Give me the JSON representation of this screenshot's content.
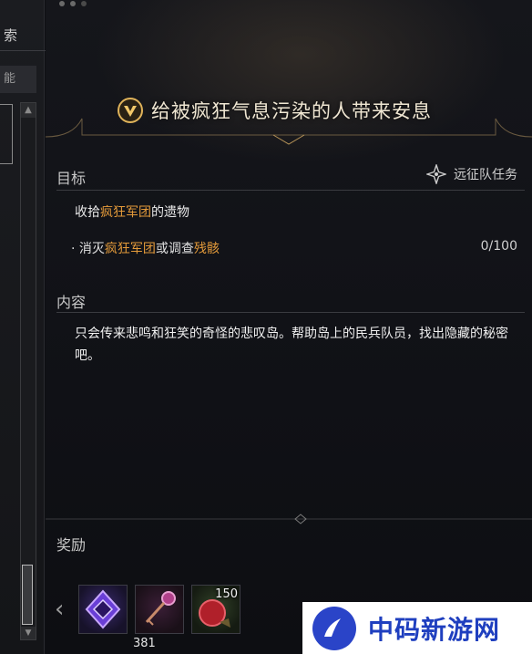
{
  "left": {
    "tab_top": "索",
    "tab_second": "能",
    "scroll_up": "▲",
    "scroll_down": "▼"
  },
  "quest": {
    "title": "给被疯狂气息污染的人带来安息",
    "icon": "quest-crest-icon"
  },
  "objective": {
    "heading": "目标",
    "type_label": "远征队任务",
    "type_icon": "expedition-star-icon",
    "main_prefix": "收拾",
    "main_highlight": "疯狂军团",
    "main_suffix": "的遗物",
    "sub_bullet": "· ",
    "sub_prefix": "消灭",
    "sub_highlight": "疯狂军团",
    "sub_middle": "或调查",
    "sub_highlight2": "残骸",
    "progress": "0/100"
  },
  "content": {
    "heading": "内容",
    "text": "只会传来悲鸣和狂笑的奇怪的悲叹岛。帮助岛上的民兵队员，找出隐藏的秘密吧。"
  },
  "rewards": {
    "heading": "奖励",
    "prev_arrow": "‹",
    "items": [
      {
        "name": "purple-crystal-icon",
        "below": "381",
        "count": ""
      },
      {
        "name": "ornate-key-icon",
        "below": "",
        "count": ""
      },
      {
        "name": "red-fruit-icon",
        "below": "",
        "count": "150"
      }
    ]
  },
  "watermark": {
    "text": "中码新游网"
  },
  "colors": {
    "highlight": "#e39a3a",
    "title": "#f0e7d3",
    "watermark": "#1f3fbf"
  }
}
